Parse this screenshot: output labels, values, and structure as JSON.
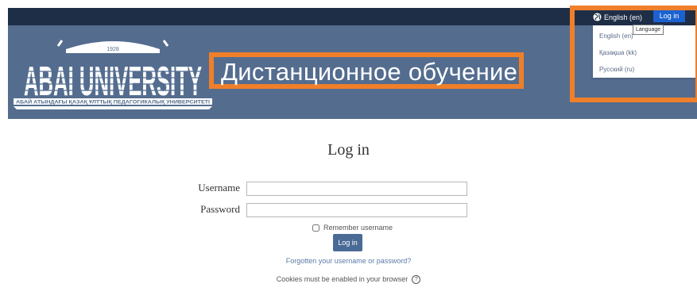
{
  "header": {
    "logo": {
      "wordmark": "ABAI UNIVERSITY",
      "year": "1928",
      "subtitle": "АБАЙ АТЫНДАҒЫ ҚАЗАҚ ҰЛТТЫҚ ПЕДАГОГИКАЛЫҚ УНИВЕРСИТЕТІ"
    },
    "title": "Дистанционное обучение"
  },
  "navbar": {
    "language_label": "English (en)",
    "login_label": "Log in",
    "tooltip": "Language",
    "languages": [
      "English (en)",
      "Қазақша (kk)",
      "Русский (ru)"
    ]
  },
  "login": {
    "heading": "Log in",
    "username_label": "Username",
    "password_label": "Password",
    "remember_label": "Remember username",
    "button_label": "Log in",
    "forgot_link": "Forgotten your username or password?",
    "cookies_text": "Cookies must be enabled in your browser"
  },
  "colors": {
    "navbar": "#1f2e47",
    "banner": "#546d8f",
    "highlight": "#f07f2a",
    "top_login_button": "#1b62d0",
    "form_button": "#4a6b95",
    "link": "#5b7ba8"
  }
}
